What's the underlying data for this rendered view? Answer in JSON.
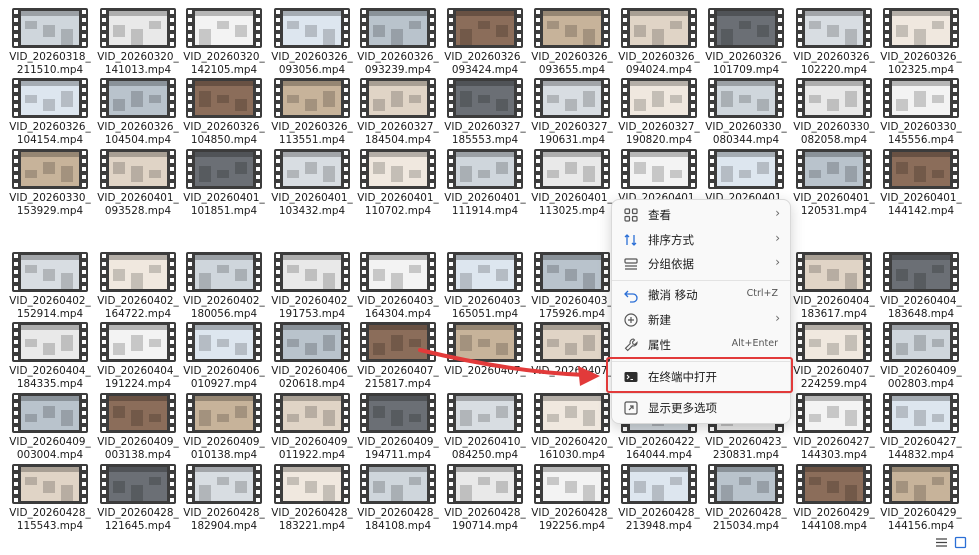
{
  "files": [
    [
      "VID_20260318_",
      "211510.mp4"
    ],
    [
      "VID_20260320_",
      "141013.mp4"
    ],
    [
      "VID_20260320_",
      "142105.mp4"
    ],
    [
      "VID_20260326_",
      "093056.mp4"
    ],
    [
      "VID_20260326_",
      "093239.mp4"
    ],
    [
      "VID_20260326_",
      "093424.mp4"
    ],
    [
      "VID_20260326_",
      "093655.mp4"
    ],
    [
      "VID_20260326_",
      "094024.mp4"
    ],
    [
      "VID_20260326_",
      "101709.mp4"
    ],
    [
      "VID_20260326_",
      "102220.mp4"
    ],
    [
      "VID_20260326_",
      "102325.mp4"
    ],
    [
      "VID_20260326_",
      "104154.mp4"
    ],
    [
      "VID_20260326_",
      "104504.mp4"
    ],
    [
      "VID_20260326_",
      "104850.mp4"
    ],
    [
      "VID_20260326_",
      "113551.mp4"
    ],
    [
      "VID_20260327_",
      "184504.mp4"
    ],
    [
      "VID_20260327_",
      "185553.mp4"
    ],
    [
      "VID_20260327_",
      "190631.mp4"
    ],
    [
      "VID_20260327_",
      "190820.mp4"
    ],
    [
      "VID_20260330_",
      "080344.mp4"
    ],
    [
      "VID_20260330_",
      "082058.mp4"
    ],
    [
      "VID_20260330_",
      "145556.mp4"
    ],
    [
      "VID_20260330_",
      "153929.mp4"
    ],
    [
      "VID_20260401_",
      "093528.mp4"
    ],
    [
      "VID_20260401_",
      "101851.mp4"
    ],
    [
      "VID_20260401_",
      "103432.mp4"
    ],
    [
      "VID_20260401_",
      "110702.mp4"
    ],
    [
      "VID_20260401_",
      "111914.mp4"
    ],
    [
      "VID_20260401_",
      "113025.mp4"
    ],
    [
      "VID_20260401_",
      ""
    ],
    [
      "VID_20260401_",
      ""
    ],
    [
      "VID_20260401_",
      "120531.mp4"
    ],
    [
      "VID_20260401_",
      "144142.mp4"
    ],
    [
      "VID_20260402_",
      "152914.mp4"
    ],
    [
      "VID_20260402_",
      "164722.mp4"
    ],
    [
      "VID_20260402_",
      "180056.mp4"
    ],
    [
      "VID_20260402_",
      "191753.mp4"
    ],
    [
      "VID_20260403_",
      "164304.mp4"
    ],
    [
      "VID_20260403_",
      "165051.mp4"
    ],
    [
      "VID_20260403_",
      "175926.mp4"
    ],
    [
      "",
      ""
    ],
    [
      "",
      ""
    ],
    [
      "VID_20260404_",
      "183617.mp4"
    ],
    [
      "VID_20260404_",
      "183648.mp4"
    ],
    [
      "VID_20260404_",
      "184335.mp4"
    ],
    [
      "VID_20260404_",
      "191224.mp4"
    ],
    [
      "VID_20260406_",
      "010927.mp4"
    ],
    [
      "VID_20260406_",
      "020618.mp4"
    ],
    [
      "VID_20260407_",
      "215817.mp4"
    ],
    [
      "VID_20260407_",
      ""
    ],
    [
      "VID_20260407_",
      ""
    ],
    [
      "",
      ""
    ],
    [
      "",
      ""
    ],
    [
      "VID_20260407_",
      "224259.mp4"
    ],
    [
      "VID_20260409_",
      "002803.mp4"
    ],
    [
      "VID_20260409_",
      "003004.mp4"
    ],
    [
      "VID_20260409_",
      "003138.mp4"
    ],
    [
      "VID_20260409_",
      "010138.mp4"
    ],
    [
      "VID_20260409_",
      "011922.mp4"
    ],
    [
      "VID_20260409_",
      "194711.mp4"
    ],
    [
      "VID_20260410_",
      "084250.mp4"
    ],
    [
      "VID_20260420_",
      "161030.mp4"
    ],
    [
      "VID_20260422_",
      "164044.mp4"
    ],
    [
      "VID_20260423_",
      "230831.mp4"
    ],
    [
      "VID_20260427_",
      "144303.mp4"
    ],
    [
      "VID_20260427_",
      "144832.mp4"
    ],
    [
      "VID_20260428_",
      "115543.mp4"
    ],
    [
      "VID_20260428_",
      "121645.mp4"
    ],
    [
      "VID_20260428_",
      "182904.mp4"
    ],
    [
      "VID_20260428_",
      "183221.mp4"
    ],
    [
      "VID_20260428_",
      "184108.mp4"
    ],
    [
      "VID_20260428_",
      "190714.mp4"
    ],
    [
      "VID_20260428_",
      "192256.mp4"
    ],
    [
      "VID_20260428_",
      "213948.mp4"
    ],
    [
      "VID_20260428_",
      "215034.mp4"
    ],
    [
      "VID_20260429_",
      "144108.mp4"
    ],
    [
      "VID_20260429_",
      "144156.mp4"
    ]
  ],
  "context_menu": {
    "view": "查看",
    "sort": "排序方式",
    "group": "分组依据",
    "undo": "撤消 移动",
    "undo_shortcut": "Ctrl+Z",
    "new": "新建",
    "properties": "属性",
    "properties_shortcut": "Alt+Enter",
    "open_terminal": "在终端中打开",
    "more_options": "显示更多选项"
  },
  "colors": {
    "highlight": "#e23a3a",
    "menu_bg": "#f9f9f9"
  }
}
